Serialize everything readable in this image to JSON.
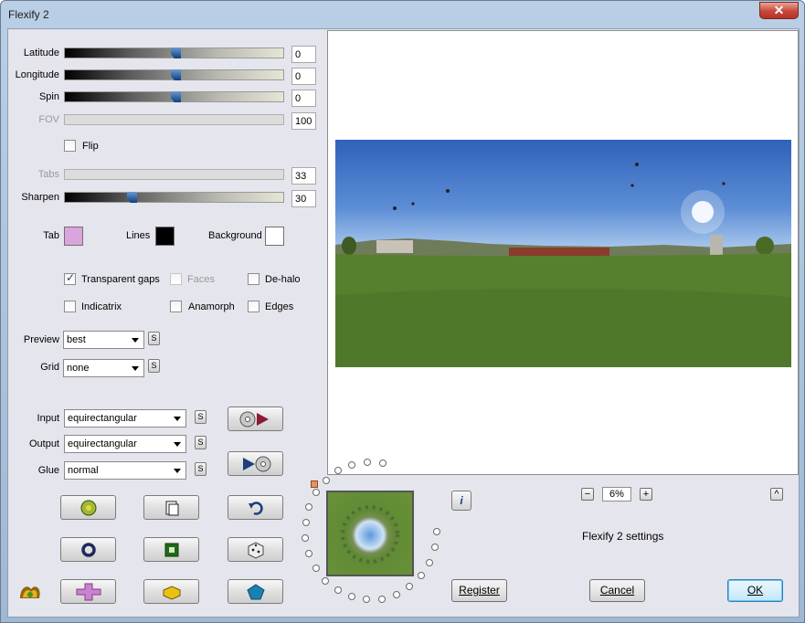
{
  "window": {
    "title": "Flexify 2",
    "close_glyph": "✕"
  },
  "sliders": [
    {
      "label": "Latitude",
      "value": "0",
      "enabled": true,
      "pos": 0.5
    },
    {
      "label": "Longitude",
      "value": "0",
      "enabled": true,
      "pos": 0.5
    },
    {
      "label": "Spin",
      "value": "0",
      "enabled": true,
      "pos": 0.5
    },
    {
      "label": "FOV",
      "value": "100",
      "enabled": false
    },
    {
      "label": "Tabs",
      "value": "33",
      "enabled": false
    },
    {
      "label": "Sharpen",
      "value": "30",
      "enabled": true,
      "pos": 0.3
    }
  ],
  "flip": {
    "label": "Flip",
    "checked": false
  },
  "colors": {
    "tab_label": "Tab",
    "tab": "#d9a5dc",
    "lines_label": "Lines",
    "lines": "#000000",
    "background_label": "Background",
    "background": "#ffffff"
  },
  "options": {
    "transparent_gaps": {
      "label": "Transparent gaps",
      "checked": true
    },
    "faces": {
      "label": "Faces",
      "checked": false,
      "enabled": false
    },
    "dehalo": {
      "label": "De-halo",
      "checked": false
    },
    "indicatrix": {
      "label": "Indicatrix",
      "checked": false
    },
    "anamorph": {
      "label": "Anamorph",
      "checked": false
    },
    "edges": {
      "label": "Edges",
      "checked": false
    }
  },
  "preview": {
    "label": "Preview",
    "value": "best"
  },
  "grid": {
    "label": "Grid",
    "value": "none"
  },
  "input": {
    "label": "Input",
    "value": "equirectangular"
  },
  "output": {
    "label": "Output",
    "value": "equirectangular"
  },
  "glue": {
    "label": "Glue",
    "value": "normal"
  },
  "s_glyph": "S",
  "zoom": {
    "minus": "−",
    "value": "6%",
    "plus": "+"
  },
  "collapse_glyph": "^",
  "info_glyph": "i",
  "status_text": "Flexify 2 settings",
  "buttons": {
    "register": "Register",
    "cancel": "Cancel",
    "ok": "OK"
  },
  "theme": {
    "accent": "#3c7fb1",
    "slider_thumb": "#0c3f7e"
  }
}
